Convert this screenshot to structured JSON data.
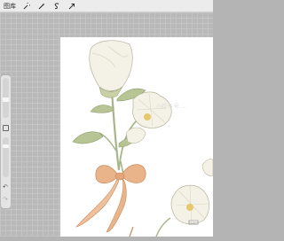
{
  "topbar": {
    "gallery_label": "图库",
    "tools": [
      {
        "name": "wrench-icon"
      },
      {
        "name": "magic-wand-icon"
      },
      {
        "name": "selection-s-icon"
      },
      {
        "name": "move-arrow-icon"
      }
    ]
  },
  "sidebar": {
    "undo_glyph": "↶",
    "redo_glyph": "↷"
  },
  "canvas": {
    "watermark": "小红书 号: ...",
    "badge": "arts"
  },
  "colors": {
    "petal": "#f4f1e6",
    "petal_shadow": "#dcd8c4",
    "stem": "#a8b58a",
    "leaf": "#b7c493",
    "ribbon": "#e9b48a",
    "ribbon_dark": "#c98a5c",
    "stamen": "#e6c76a"
  }
}
